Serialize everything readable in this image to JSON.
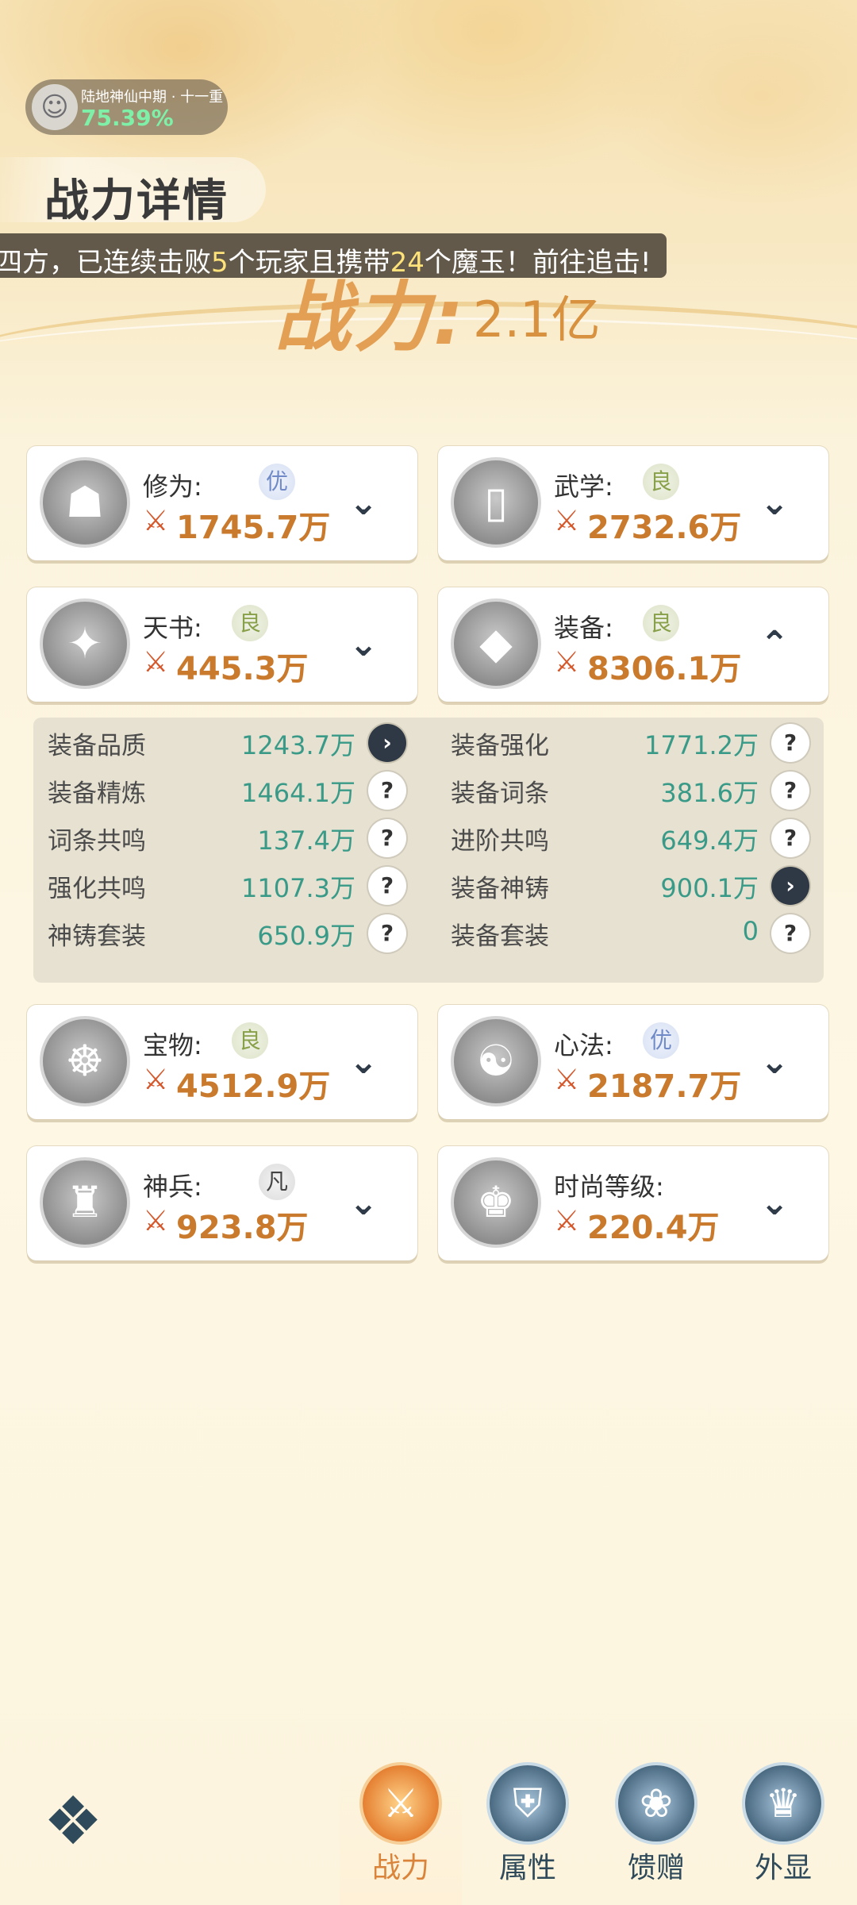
{
  "header": {
    "realm_title": "陆地神仙中期 · 十一重",
    "realm_percent": "75.39%",
    "page_title": "战力详情",
    "marquee_prefix": "四方，已连续击败",
    "marquee_count1": "5",
    "marquee_mid": "个玩家且携带",
    "marquee_count2": "24",
    "marquee_suffix": "个魔玉！前往追击!",
    "power_label": "战力:",
    "power_value": "2.1亿"
  },
  "cards": [
    {
      "label": "修为:",
      "grade": "优",
      "value": "1745.7万",
      "toggle": "expand"
    },
    {
      "label": "武学:",
      "grade": "良",
      "value": "2732.6万",
      "toggle": "expand"
    },
    {
      "label": "天书:",
      "grade": "良",
      "value": "445.3万",
      "toggle": "expand"
    },
    {
      "label": "装备:",
      "grade": "良",
      "value": "8306.1万",
      "toggle": "collapse"
    },
    {
      "label": "宝物:",
      "grade": "良",
      "value": "4512.9万",
      "toggle": "expand"
    },
    {
      "label": "心法:",
      "grade": "优",
      "value": "2187.7万",
      "toggle": "expand"
    },
    {
      "label": "神兵:",
      "grade": "凡",
      "value": "923.8万",
      "toggle": "expand"
    },
    {
      "label": "时尚等级:",
      "grade": "",
      "value": "220.4万",
      "toggle": "expand"
    }
  ],
  "equipment_details": [
    {
      "label": "装备品质",
      "value": "1243.7万",
      "action": "arrow"
    },
    {
      "label": "装备强化",
      "value": "1771.2万",
      "action": "help"
    },
    {
      "label": "装备精炼",
      "value": "1464.1万",
      "action": "help"
    },
    {
      "label": "装备词条",
      "value": "381.6万",
      "action": "help"
    },
    {
      "label": "词条共鸣",
      "value": "137.4万",
      "action": "help"
    },
    {
      "label": "进阶共鸣",
      "value": "649.4万",
      "action": "help"
    },
    {
      "label": "强化共鸣",
      "value": "1107.3万",
      "action": "help"
    },
    {
      "label": "装备神铸",
      "value": "900.1万",
      "action": "arrow"
    },
    {
      "label": "神铸套装",
      "value": "650.9万",
      "action": "help"
    },
    {
      "label": "装备套装",
      "value": "0",
      "action": "help"
    }
  ],
  "glyphs": {
    "arrow": "›",
    "help": "?",
    "expand": "⌄",
    "collapse": "⌃",
    "power": "⚔"
  },
  "bottom_nav": {
    "tabs": [
      {
        "label": "战力",
        "icon": "crossed-swords-icon",
        "active": true
      },
      {
        "label": "属性",
        "icon": "shield-emblem-icon",
        "active": false
      },
      {
        "label": "馈赠",
        "icon": "gift-bag-icon",
        "active": false
      },
      {
        "label": "外显",
        "icon": "crown-emblem-icon",
        "active": false
      }
    ]
  },
  "colors": {
    "accent": "#d9843a",
    "value_green": "#3a9a88",
    "power_orange": "#c97a2c"
  }
}
